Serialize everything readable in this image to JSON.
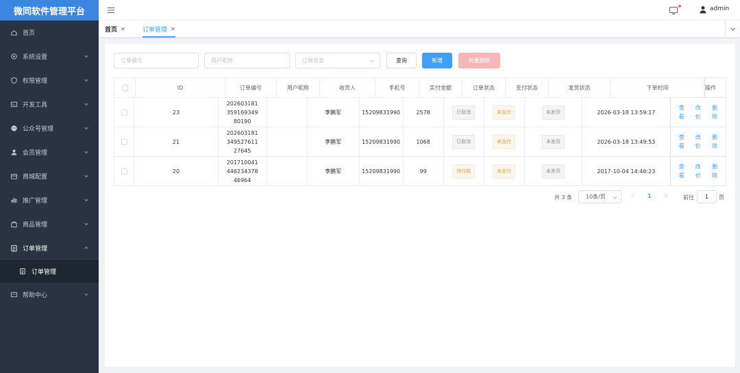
{
  "sidebar": {
    "brand": "微同软件管理平台",
    "items": [
      {
        "label": "首页",
        "icon": "home-icon",
        "has_arrow": false
      },
      {
        "label": "系统设置",
        "icon": "settings-icon",
        "has_arrow": true
      },
      {
        "label": "权限管理",
        "icon": "shield-icon",
        "has_arrow": true
      },
      {
        "label": "开发工具",
        "icon": "code-icon",
        "has_arrow": true
      },
      {
        "label": "公众号管理",
        "icon": "wechat-icon",
        "has_arrow": true
      },
      {
        "label": "会员管理",
        "icon": "user-icon",
        "has_arrow": true
      },
      {
        "label": "商城配置",
        "icon": "shop-icon",
        "has_arrow": true
      },
      {
        "label": "推广管理",
        "icon": "promote-icon",
        "has_arrow": true
      },
      {
        "label": "商品管理",
        "icon": "goods-icon",
        "has_arrow": true
      },
      {
        "label": "订单管理",
        "icon": "clipboard-icon",
        "has_arrow": true,
        "open": true
      },
      {
        "label": "帮助中心",
        "icon": "help-icon",
        "has_arrow": true
      }
    ],
    "submenu": {
      "label": "订单管理",
      "icon": "clipboard-icon"
    }
  },
  "header": {
    "user": "admin"
  },
  "tabs": [
    {
      "label": "首页",
      "active": false
    },
    {
      "label": "订单管理",
      "active": true
    }
  ],
  "filters": {
    "order_no_placeholder": "订单编号",
    "nickname_placeholder": "用户昵称",
    "status_placeholder": "订单状态",
    "query_label": "查询",
    "add_label": "新增",
    "batch_delete_label": "批量删除"
  },
  "table": {
    "columns": [
      "ID",
      "订单编号",
      "用户昵称",
      "收货人",
      "手机号",
      "实付金额",
      "订单状态",
      "支付状态",
      "发货状态",
      "下单时间",
      "操作"
    ],
    "rows": [
      {
        "id": "23",
        "order_no": "20260318135916934980190",
        "nickname": "",
        "receiver": "李鹏军",
        "phone": "15209831990",
        "amount": "2578",
        "order_status": "已取消",
        "order_status_type": "info",
        "pay_status": "未支付",
        "ship_status": "未发货",
        "time": "2026-03-18 13:59:17"
      },
      {
        "id": "21",
        "order_no": "20260318134952761127645",
        "nickname": "",
        "receiver": "李鹏军",
        "phone": "15209831990",
        "amount": "1068",
        "order_status": "已取消",
        "order_status_type": "info",
        "pay_status": "未支付",
        "ship_status": "未发货",
        "time": "2026-03-18 13:49:53"
      },
      {
        "id": "20",
        "order_no": "20171004144623437846964",
        "nickname": "",
        "receiver": "李鹏军",
        "phone": "15209831990",
        "amount": "99",
        "order_status": "待付款",
        "order_status_type": "warn",
        "pay_status": "未支付",
        "ship_status": "未发货",
        "time": "2017-10-04 14:46:23"
      }
    ],
    "ops": [
      "查看",
      "改价",
      "删除"
    ]
  },
  "pagination": {
    "total": "共 3 条",
    "page_size": "10条/页",
    "current": "1",
    "goto_label": "前往",
    "goto_value": "1",
    "page_label": "页"
  },
  "colors": {
    "brand": "#3a86e0",
    "sidebar_bg": "#2b3241",
    "primary": "#409eff",
    "danger_light": "#fab6b6"
  }
}
